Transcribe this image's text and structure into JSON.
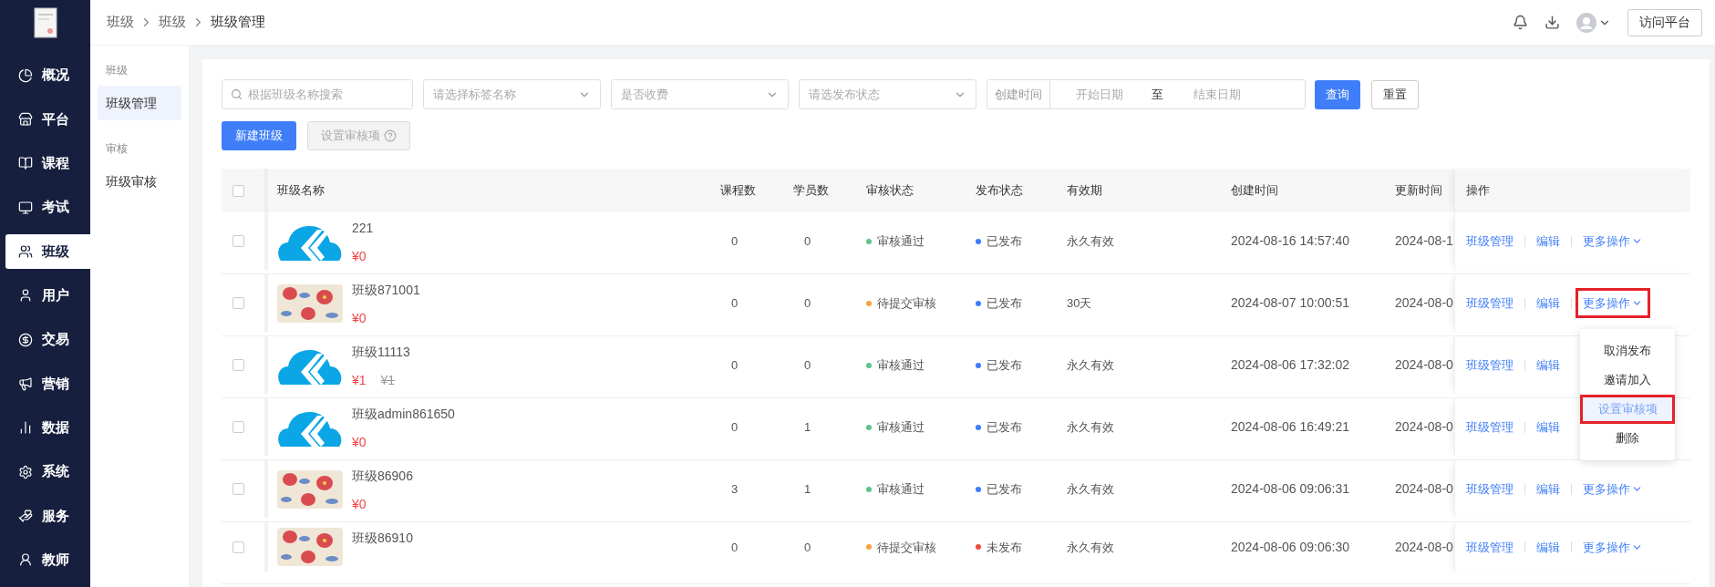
{
  "breadcrumb": [
    "班级",
    "班级",
    "班级管理"
  ],
  "header": {
    "visit_button": "访问平台"
  },
  "sidebar": {
    "items": [
      {
        "label": "概况",
        "selected": false
      },
      {
        "label": "平台",
        "selected": false
      },
      {
        "label": "课程",
        "selected": false
      },
      {
        "label": "考试",
        "selected": false
      },
      {
        "label": "班级",
        "selected": true
      },
      {
        "label": "用户",
        "selected": false
      },
      {
        "label": "交易",
        "selected": false
      },
      {
        "label": "营销",
        "selected": false
      },
      {
        "label": "数据",
        "selected": false
      },
      {
        "label": "系统",
        "selected": false
      },
      {
        "label": "服务",
        "selected": false
      },
      {
        "label": "教师",
        "selected": false
      }
    ]
  },
  "submenu": {
    "groups": [
      {
        "title": "班级",
        "items": [
          {
            "label": "班级管理",
            "selected": true
          }
        ]
      },
      {
        "title": "审核",
        "items": [
          {
            "label": "班级审核",
            "selected": false
          }
        ]
      }
    ]
  },
  "filters": {
    "search": {
      "placeholder": "根据班级名称搜索"
    },
    "selects": [
      {
        "placeholder": "请选择标签名称"
      },
      {
        "placeholder": "是否收费"
      },
      {
        "placeholder": "请选发布状态"
      }
    ],
    "date_range": {
      "label": "创建时间",
      "start_placeholder": "开始日期",
      "separator": "至",
      "end_placeholder": "结束日期"
    },
    "query_button": "查询",
    "reset_button": "重置"
  },
  "actions": {
    "new_button": "新建班级",
    "audit_button": {
      "label": "设置审核项",
      "disabled": true
    }
  },
  "table": {
    "all_checked": false,
    "columns": [
      "班级名称",
      "课程数",
      "学员数",
      "审核状态",
      "发布状态",
      "有效期",
      "创建时间",
      "更新时间",
      "操作"
    ],
    "rows": [
      {
        "checked": false,
        "thumbnail": {
          "kind": "logo"
        },
        "name": "221",
        "price": "¥0",
        "courses": "0",
        "students": "0",
        "audit": {
          "label": "审核通过",
          "color": "#5cc48a"
        },
        "publish": {
          "label": "已发布",
          "color": "#3d7bff"
        },
        "validity": "永久有效",
        "created": "2024-08-16 14:57:40",
        "updated": "2024-08-1",
        "ops": [
          "班级管理",
          "编辑"
        ],
        "more": {
          "label": "更多操作",
          "annotated": false
        }
      },
      {
        "checked": false,
        "thumbnail": {
          "kind": "picture"
        },
        "name": "班级871001",
        "price": "¥0",
        "courses": "0",
        "students": "0",
        "audit": {
          "label": "待提交审核",
          "color": "#f7a23b"
        },
        "publish": {
          "label": "已发布",
          "color": "#3d7bff"
        },
        "validity": "30天",
        "created": "2024-08-07 10:00:51",
        "updated": "2024-08-0",
        "ops": [
          "班级管理",
          "编辑"
        ],
        "more": {
          "label": "更多操作",
          "annotated": true
        },
        "menu": [
          {
            "label": "取消发布",
            "selected": false,
            "annotated": false
          },
          {
            "label": "邀请加入",
            "selected": false,
            "annotated": false
          },
          {
            "label": "设置审核项",
            "selected": true,
            "annotated": true
          },
          {
            "label": "删除",
            "selected": false,
            "annotated": false
          }
        ]
      },
      {
        "checked": false,
        "thumbnail": {
          "kind": "logo"
        },
        "name": "班级11113",
        "price": "¥1",
        "original_price": "¥1",
        "courses": "0",
        "students": "0",
        "audit": {
          "label": "审核通过",
          "color": "#5cc48a"
        },
        "publish": {
          "label": "已发布",
          "color": "#3d7bff"
        },
        "validity": "永久有效",
        "created": "2024-08-06 17:32:02",
        "updated": "2024-08-0",
        "ops": [
          "班级管理",
          "编辑"
        ]
      },
      {
        "checked": false,
        "thumbnail": {
          "kind": "logo"
        },
        "name": "班级admin861650",
        "price": "¥0",
        "courses": "0",
        "students": "1",
        "audit": {
          "label": "审核通过",
          "color": "#5cc48a"
        },
        "publish": {
          "label": "已发布",
          "color": "#3d7bff"
        },
        "validity": "永久有效",
        "created": "2024-08-06 16:49:21",
        "updated": "2024-08-0",
        "ops": [
          "班级管理",
          "编辑"
        ]
      },
      {
        "checked": false,
        "thumbnail": {
          "kind": "picture"
        },
        "name": "班级86906",
        "price": "¥0",
        "courses": "3",
        "students": "1",
        "audit": {
          "label": "审核通过",
          "color": "#5cc48a"
        },
        "publish": {
          "label": "已发布",
          "color": "#3d7bff"
        },
        "validity": "永久有效",
        "created": "2024-08-06 09:06:31",
        "updated": "2024-08-0",
        "ops": [
          "班级管理",
          "编辑"
        ],
        "more": {
          "label": "更多操作",
          "annotated": false
        }
      },
      {
        "checked": false,
        "thumbnail": {
          "kind": "picture"
        },
        "name": "班级86910",
        "courses": "0",
        "students": "0",
        "audit": {
          "label": "待提交审核",
          "color": "#f7a23b"
        },
        "publish": {
          "label": "未发布",
          "color": "#f0483e"
        },
        "validity": "永久有效",
        "created": "2024-08-06 09:06:30",
        "updated": "2024-08-0",
        "ops": [
          "班级管理",
          "编辑"
        ],
        "more": {
          "label": "更多操作",
          "annotated": false
        }
      }
    ]
  }
}
